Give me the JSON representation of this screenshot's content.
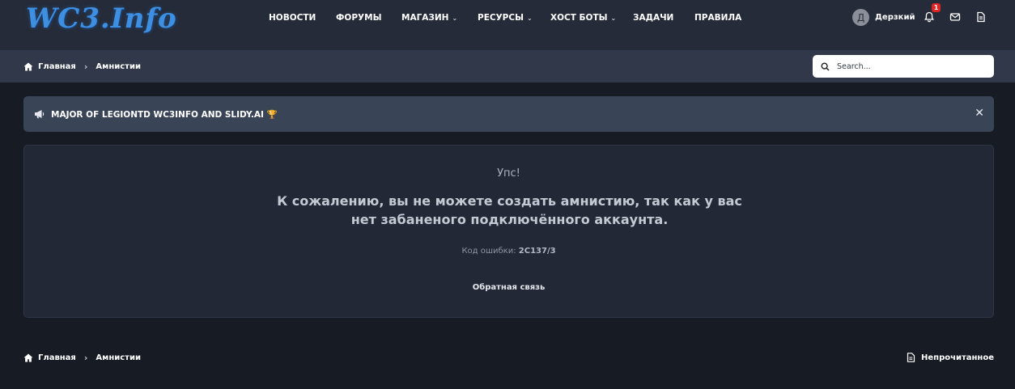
{
  "logo": {
    "text": "WC3.Info"
  },
  "nav": [
    {
      "label": "НОВОСТИ"
    },
    {
      "label": "ФОРУМЫ"
    },
    {
      "label": "МАГАЗИН",
      "dropdown": true
    },
    {
      "label": "РЕСУРСЫ",
      "dropdown": true
    },
    {
      "label": "ХОСТ БОТЫ",
      "dropdown": true
    },
    {
      "label": "ЗАДАЧИ"
    },
    {
      "label": "ПРАВИЛА"
    }
  ],
  "user": {
    "initial": "Д",
    "name": "Дерзкий",
    "notifications_count": "1"
  },
  "icons": {
    "bell": "bell-icon",
    "mail": "envelope-icon",
    "doc": "document-icon",
    "home": "home-icon",
    "megaphone": "megaphone-icon",
    "search": "search-icon"
  },
  "breadcrumb": {
    "home": "Главная",
    "current": "Амнистии"
  },
  "search": {
    "placeholder": "Search..."
  },
  "notice": {
    "text": "MAJOR OF LEGIONTD WC3INFO AND SLIDY.AI 🏆",
    "close": "✕"
  },
  "error": {
    "title": "Упс!",
    "message": "К сожалению, вы не можете создать амнистию, так как у вас нет забаненого подключённого аккаунта.",
    "code_label": "Код ошибки:",
    "code_value": "2C137/3",
    "feedback": "Обратная связь"
  },
  "footer": {
    "home": "Главная",
    "current": "Амнистии",
    "unread": "Непрочитанное"
  },
  "colors": {
    "header": "#252b38",
    "crumbbar": "#313849",
    "notice": "#3a4457",
    "panel": "#222835",
    "page": "#171b24",
    "accent": "#3f8fe0",
    "badge": "#e02424"
  }
}
